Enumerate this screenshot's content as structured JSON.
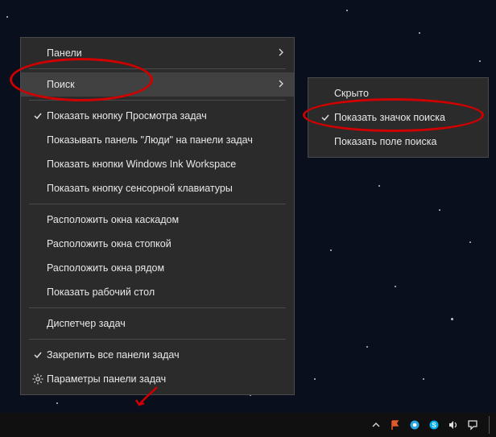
{
  "main_menu": {
    "items": [
      {
        "label": "Панели",
        "arrow": true
      },
      {
        "label": "Поиск",
        "arrow": true,
        "hover": true
      },
      {
        "label": "Показать кнопку Просмотра задач",
        "check": true
      },
      {
        "label": "Показывать панель \"Люди\" на панели задач"
      },
      {
        "label": "Показать кнопки Windows Ink Workspace"
      },
      {
        "label": "Показать кнопку сенсорной клавиатуры"
      },
      {
        "sep": true
      },
      {
        "label": "Расположить окна каскадом"
      },
      {
        "label": "Расположить окна стопкой"
      },
      {
        "label": "Расположить окна рядом"
      },
      {
        "label": "Показать рабочий стол"
      },
      {
        "sep": true
      },
      {
        "label": "Диспетчер задач"
      },
      {
        "sep": true
      },
      {
        "label": "Закрепить все панели задач",
        "check": true
      },
      {
        "label": "Параметры панели задач",
        "gear": true
      }
    ]
  },
  "sub_menu": {
    "items": [
      {
        "label": "Скрыто"
      },
      {
        "label": "Показать значок поиска",
        "check": true
      },
      {
        "label": "Показать поле поиска"
      }
    ]
  },
  "tray": {
    "icons": [
      "chevron-up",
      "flag",
      "globe",
      "skype",
      "volume",
      "action-center"
    ]
  }
}
